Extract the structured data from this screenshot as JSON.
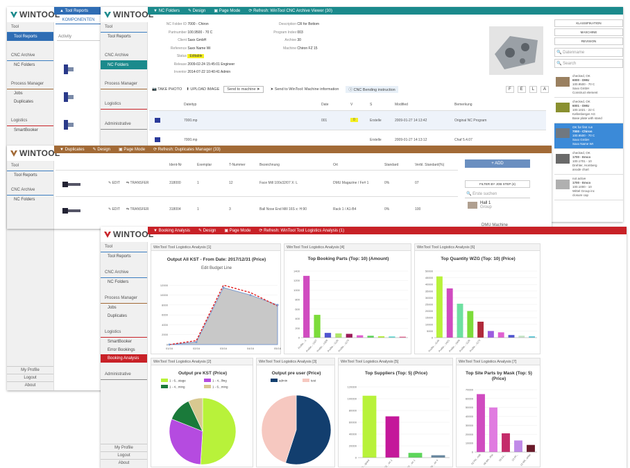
{
  "brand": "WINTOOL",
  "win1": {
    "nav_sections": [
      "Tool",
      "CNC Archive",
      "Process Manager",
      "Logistics"
    ],
    "nav_items": {
      "tool": [
        "Tool Reports"
      ],
      "cnc": [
        "NC Folders"
      ],
      "pm": [
        "Jobs",
        "Duplicates"
      ],
      "log": [
        "SmartBooker"
      ]
    },
    "bottom": [
      "My Profile",
      "Logout",
      "About"
    ],
    "tab": "Tool Reports",
    "sub": "KOMPONENTEN",
    "sub2": "Activity"
  },
  "win2": {
    "nav_sections": [
      "Tool",
      "CNC Archive",
      "Process Manager",
      "Logistics",
      "Administrative"
    ],
    "nav_items": {
      "tool": [
        "Tool Reports"
      ],
      "cnc": [
        "NC Folders"
      ]
    },
    "bar": [
      "NC Folders",
      "Design",
      "Page Mode",
      "Refresh: WinTool CNC Archive Viewer (30)"
    ],
    "detail": [
      [
        "NC Folder ID",
        "7000 - Chiron"
      ],
      [
        "Partnumber",
        "100.9500 - 70 C"
      ],
      [
        "Client",
        "Saxx GmbH"
      ],
      [
        "Reference",
        "Saxx Name Wi"
      ],
      [
        "Status",
        "Editable"
      ],
      [
        "Release",
        "2009-02-24 15:45:01 Engineer"
      ],
      [
        "Inventor",
        "2014-07-22 10:40:41 Admin"
      ]
    ],
    "detail2": [
      [
        "Description",
        "CR for Bottom"
      ],
      [
        "Program Index",
        "003"
      ],
      [
        "Archive",
        "30"
      ],
      [
        "Machine",
        "Chiron FZ 15"
      ]
    ],
    "actions": [
      "TAKE PHOTO",
      "UPLOAD IMAGE",
      "Send to machine",
      "Send to WinTool: Machine information",
      "CNC Bending instruction"
    ],
    "pager": [
      "F",
      "E",
      "L",
      "A"
    ],
    "cols": [
      "Dateityp",
      "Date",
      "V",
      "S",
      "Modified",
      "Bemerkung"
    ],
    "rows": [
      [
        "7000.mp",
        "001",
        "0",
        "Erstelle",
        "2009-01-27 14:13:42",
        "Original NC Program"
      ],
      [
        "7000.mp",
        "",
        "",
        "Erstelle",
        "2009-01-27 14:13:12",
        "Chaf 5.4.07"
      ]
    ],
    "side_btns": [
      "KLASSIFIKATION",
      "MASCHINE",
      "REVISION"
    ],
    "search1": "Datenname",
    "search2": "Search",
    "items": [
      {
        "h": "checked, OK",
        "t": "6000 - DMU",
        "s": "100.9500 - 70 C",
        "s2": "Saxx GmbH",
        "s3": "Construct element"
      },
      {
        "h": "checked, OK",
        "t": "6001 - DMU",
        "s": "100.1021 - 22 C",
        "s2": "Kellenberger AG",
        "s3": "Base plate with stand"
      },
      {
        "h": "OK for first run",
        "t": "7000 - Chiron",
        "s": "100.9500 - 70 C",
        "s2": "Saxx GmbH",
        "s3": "Saxx Name WI"
      },
      {
        "h": "checked, OK",
        "t": "1700 - Emco",
        "s": "100.1701 - 10",
        "s2": "Drehler, Homberg",
        "s3": "anode chart"
      },
      {
        "h": "not active",
        "t": "1700 - Emco",
        "s": "100.1000 - 10",
        "s2": "Wittel Group inc",
        "s3": "closure cap"
      }
    ]
  },
  "win3": {
    "bar": [
      "Duplicates",
      "Design",
      "Page Mode",
      "Refresh: Duplicates Manager (33)"
    ],
    "cols": [
      "Ident-Nr",
      "Exemplar",
      "T-Nummer",
      "Bezeichnung",
      "Ort",
      "Standard",
      "Verbl. Standard(%)"
    ],
    "rows": [
      [
        "318000",
        "1",
        "12",
        "Face Mill 100x32/07 X: L",
        "DMU Magazine / Fe# 1",
        "0%",
        "07"
      ],
      [
        "318004",
        "1",
        "3",
        "Ball Nose End Mill 16S x: H:90",
        "Rack 1 / A1-B4",
        "0%",
        "100"
      ]
    ],
    "edit": "EDIT",
    "transfer": "TRANSFER",
    "add": "+ ADD",
    "filter": "FILTER BY JOB STEP (4)",
    "find": "Erste suchen",
    "hall": "Hall 1",
    "hall_sub": "Group",
    "machine": "DMU Machine"
  },
  "win4": {
    "nav_sections": [
      "Tool",
      "CNC Archive",
      "Process Manager",
      "Logistics",
      "Administrative"
    ],
    "nav_items": {
      "tool": [
        "Tool Reports"
      ],
      "cnc": [
        "NC Folders"
      ],
      "pm": [
        "Jobs",
        "Duplicates"
      ],
      "log": [
        "SmartBooker",
        "Error Bookings",
        "Booking Analysis"
      ]
    },
    "bottom": [
      "My Profile",
      "Logout",
      "About"
    ],
    "bar": [
      "Booking Analysis",
      "Design",
      "Page Mode",
      "Refresh: WinTool Tool Logistics Analysis (1)"
    ]
  },
  "cards": [
    {
      "h": "WinTool Tool Logistics Analysis [1]"
    },
    {
      "h": "WinTool Tool Logistics Analysis [4]"
    },
    {
      "h": "WinTool Tool Logistics Analysis [6]"
    },
    {
      "h": "WinTool Tool Logistics Analysis [2]"
    },
    {
      "h": "WinTool Tool Logistics Analysis [3]"
    },
    {
      "h": "WinTool Tool Logistics Analysis [5]"
    },
    {
      "h": "WinTool Tool Logistics Analysis [7]"
    }
  ],
  "colors": {
    "teal": "#1b8a8c",
    "brown": "#a26a36",
    "red": "#c82127",
    "blue": "#2f6db4",
    "lime": "#b8f23a",
    "pink": "#d04bc0",
    "orange": "#e8651a"
  },
  "chart_data": [
    {
      "type": "area",
      "title": "Output All KST - From Date: 2017/12/31 (Price)",
      "subtitle": "Edit Budget Line",
      "x": [
        "01/16",
        "02/16",
        "03/16",
        "04/16",
        "05/16"
      ],
      "series": [
        {
          "values": [
            0,
            500,
            11500,
            10000,
            8000
          ]
        },
        {
          "values": [
            0,
            800,
            12000,
            10500,
            7800
          ]
        }
      ],
      "ylim": [
        0,
        14000
      ],
      "yticks": [
        0,
        2000,
        4000,
        6000,
        8000,
        10000,
        12000
      ]
    },
    {
      "type": "bar",
      "title": "Top Booking Parts (Top: 10) (Amount)",
      "categories": [
        "Profile...-1",
        "Profile...-1327",
        "Profile...-1328",
        "Profile...-1120",
        "Profile...-1173",
        "a",
        "b",
        "c",
        "d",
        "e"
      ],
      "values": [
        1300,
        480,
        100,
        90,
        80,
        50,
        40,
        30,
        25,
        20
      ],
      "ylim": [
        0,
        1400
      ],
      "colors": [
        "#d04bc0",
        "#7cdc3a",
        "#5055d0",
        "#aee66a",
        "#9b1b58",
        "#e05fd0",
        "#5dd65a",
        "#b8f23a",
        "#58d8d0",
        "#e85b8a"
      ]
    },
    {
      "type": "bar",
      "title": "Top Quantity WZG (Top: 10) (Price)",
      "categories": [
        "Profile...-1140",
        "Profile...-1021",
        "Profile...-1009",
        "Profile...-1120",
        "Profile...-1173",
        "a",
        "b",
        "c",
        "d",
        "e"
      ],
      "values": [
        46000,
        37000,
        25500,
        20000,
        12000,
        5000,
        4000,
        2000,
        1500,
        1000
      ],
      "ylim": [
        0,
        50000
      ],
      "colors": [
        "#b8f23a",
        "#d04bc0",
        "#6ee0a0",
        "#7cdc3a",
        "#b02a3a",
        "#9b5cdf",
        "#e05fd0",
        "#5055d0",
        "#c8e6c8",
        "#58c8d8"
      ]
    },
    {
      "type": "pie",
      "title": "Output pre KST (Price)",
      "legend": [
        "1 - 6...stage",
        "1 - 4...lling",
        "1 - 4...ming",
        "1 - 6...ming"
      ],
      "values": [
        51,
        30,
        12,
        7
      ],
      "colors": [
        "#b8f23a",
        "#b54be0",
        "#1a7a3a",
        "#d8c890"
      ]
    },
    {
      "type": "pie",
      "title": "Output pre user (Price)",
      "legend": [
        "admin",
        "test"
      ],
      "values": [
        55,
        45
      ],
      "colors": [
        "#123e6e",
        "#f6c8c0"
      ]
    },
    {
      "type": "bar",
      "title": "Top Suppliers (Top: 5) (Price)",
      "categories": [
        "L-00 ...igned",
        "L-02 ...ier 2",
        "L-07 ...ier 1",
        "L-00 ...ier 4"
      ],
      "values": [
        105000,
        70000,
        8000,
        4000
      ],
      "ylim": [
        0,
        120000
      ],
      "colors": [
        "#b8f23a",
        "#c4189a",
        "#5dd65a",
        "#6888a0"
      ]
    },
    {
      "type": "bar",
      "title": "Top Site Parts by Mask (Top: 5) (Price)",
      "categories": [
        "02 PN...rstb",
        "08 WA...tfrei",
        "09 KA...",
        "10 PF...",
        "13 NR...arbei"
      ],
      "values": [
        65000,
        50000,
        21000,
        13000,
        8000
      ],
      "ylim": [
        0,
        70000
      ],
      "colors": [
        "#d04bc0",
        "#e07be0",
        "#c42c6a",
        "#c08ae8",
        "#6a1a2a"
      ]
    }
  ]
}
